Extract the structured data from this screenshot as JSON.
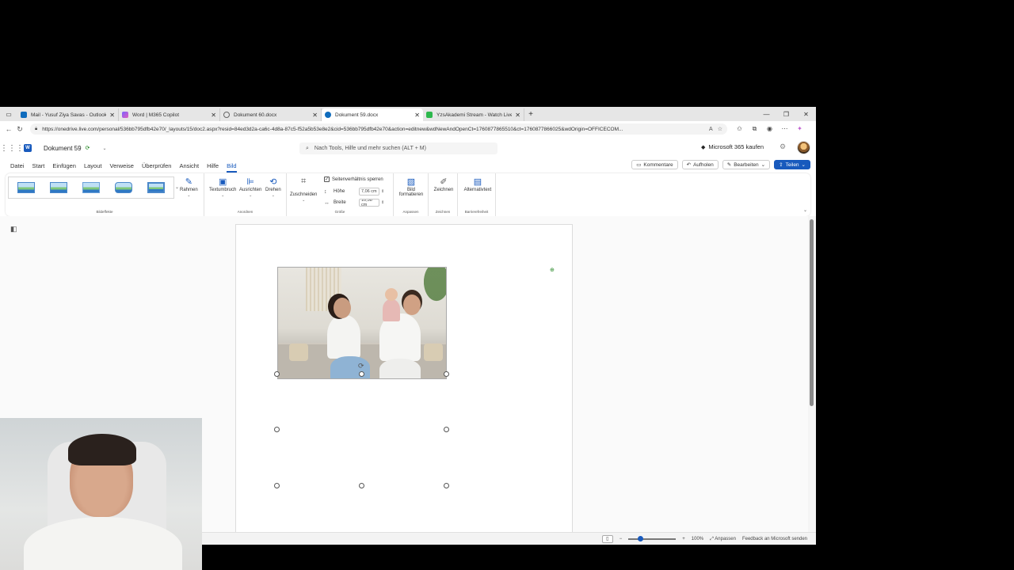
{
  "browser": {
    "tabs": [
      {
        "title": "Mail - Yusuf Ziya Savas - Outlook",
        "favicon_color": "#0f6cbd",
        "active": false
      },
      {
        "title": "Word | M365 Copilot",
        "favicon_color": "#7b61ff",
        "active": false
      },
      {
        "title": "Dokument 60.docx",
        "favicon_color": "#666666",
        "active": false
      },
      {
        "title": "Dokument 59.docx",
        "favicon_color": "#0f6cbd",
        "active": true
      },
      {
        "title": "YzsAkademi Stream - Watch Live",
        "favicon_color": "#2db84d",
        "active": false
      }
    ],
    "url": "https://onedrive.live.com/personal/536bb795dfb42e70/_layouts/15/doc2.aspx?resid=84ed3d2a-ca6c-4d8a-87c5-f52a5b53e8e2&cid=536bb795dfb42e70&action=editnew&wdNewAndOpenCt=1760877865510&ct=1760877866025&wdOrigin=OFFICECOM..."
  },
  "app": {
    "doc_title": "Dokument 59",
    "search_placeholder": "Nach Tools, Hilfe und mehr suchen (ALT + M)",
    "buy_365": "Microsoft 365 kaufen",
    "menu_tabs": [
      "Datei",
      "Start",
      "Einfügen",
      "Layout",
      "Verweise",
      "Überprüfen",
      "Ansicht",
      "Hilfe",
      "Bild"
    ],
    "active_menu_tab": "Bild",
    "right_buttons": {
      "comments": "Kommentare",
      "catchup": "Aufholen",
      "edit": "Bearbeiten",
      "share": "Teilen"
    }
  },
  "ribbon": {
    "groups": {
      "styles": "Bildeffekte",
      "arrange": "Anordnen",
      "size": "Größe",
      "adjust": "Anpassen",
      "draw": "Zeichnen",
      "accessibility": "Barrierefreiheit"
    },
    "buttons": {
      "border": "Rahmen",
      "wrap": "Textumbruch",
      "align": "Ausrichten",
      "rotate": "Drehen",
      "crop": "Zuschneiden",
      "format_line1": "Bild",
      "format_line2": "formatieren",
      "draw": "Zeichnen",
      "alt_text": "Alternativtext"
    },
    "size": {
      "lock_ratio": "Seitenverhältnis sperren",
      "lock_ratio_checked": true,
      "height_label": "Höhe",
      "height_value": "7,06 cm",
      "width_label": "Breite",
      "width_value": "10,58 cm"
    }
  },
  "statusbar": {
    "zoom": "100%",
    "fit": "Anpassen",
    "feedback": "Feedback an Microsoft senden",
    "zoom_level": 0.25
  },
  "colors": {
    "accent": "#185abd",
    "saved": "#107c10"
  }
}
